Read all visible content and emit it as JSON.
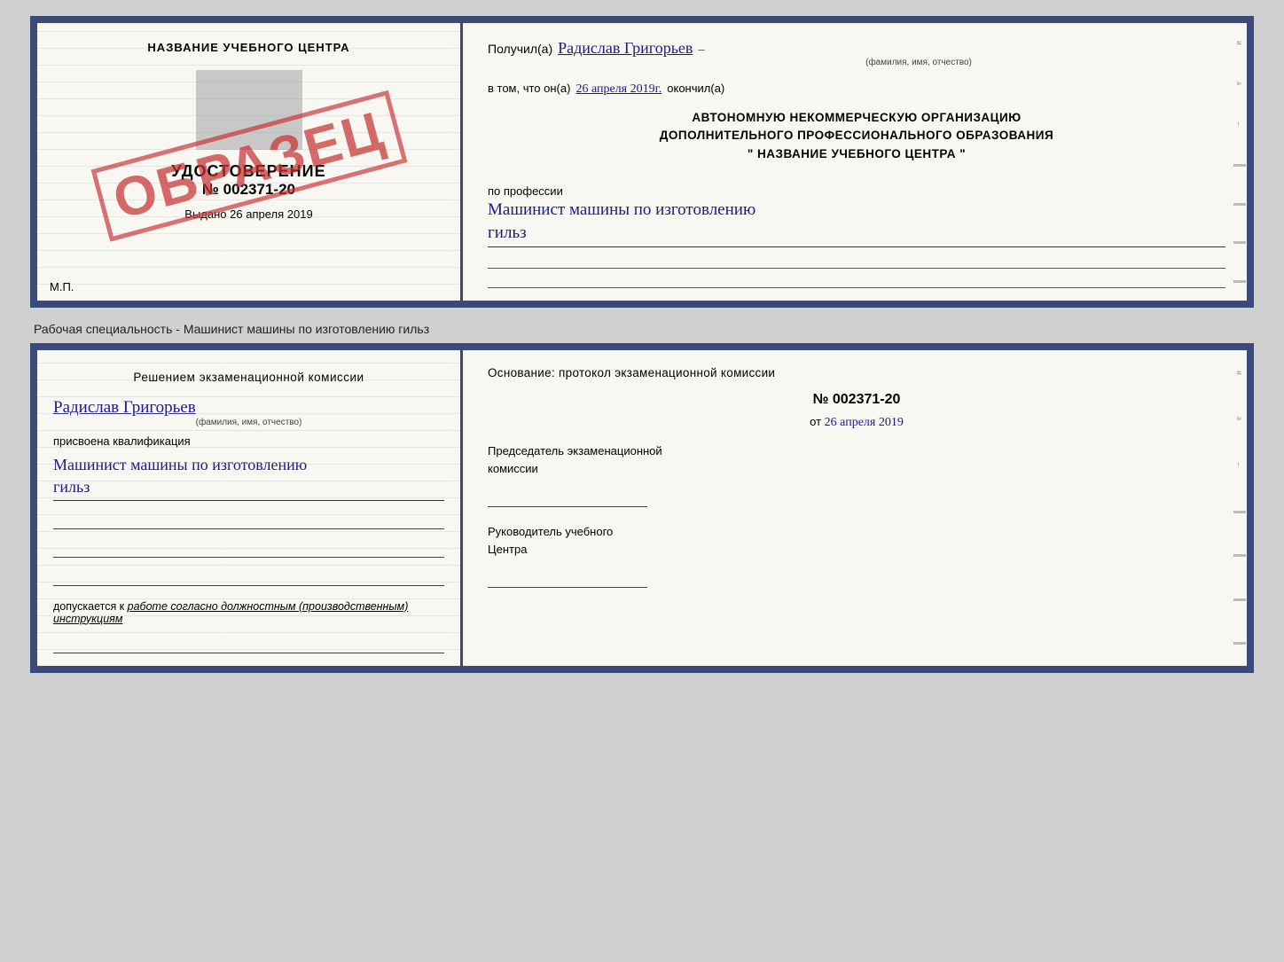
{
  "top_cert": {
    "left": {
      "school_name": "НАЗВАНИЕ УЧЕБНОГО ЦЕНТРА",
      "udostoverenie_label": "УДОСТОВЕРЕНИЕ",
      "udostoverenie_number": "№ 002371-20",
      "vidan_label": "Выдано",
      "vidan_date": "26 апреля 2019",
      "mp_label": "М.П.",
      "obrazec": "ОБРАЗЕЦ"
    },
    "right": {
      "poluchil_prefix": "Получил(а)",
      "poluchil_name": "Радислав Григорьев",
      "poluchil_caption": "(фамилия, имя, отчество)",
      "vtom_prefix": "в том, что он(а)",
      "vtom_date": "26 апреля 2019г.",
      "vtom_suffix": "окончил(а)",
      "body_line1": "АВТОНОМНУЮ НЕКОММЕРЧЕСКУЮ ОРГАНИЗАЦИЮ",
      "body_line2": "ДОПОЛНИТЕЛЬНОГО ПРОФЕССИОНАЛЬНОГО ОБРАЗОВАНИЯ",
      "body_line3": "\"   НАЗВАНИЕ УЧЕБНОГО ЦЕНТРА   \"",
      "po_professii_label": "по профессии",
      "profession_handwritten": "Машинист машины по изготовлению",
      "profession_line2": "гильз"
    }
  },
  "middle_label": "Рабочая специальность - Машинист машины по изготовлению гильз",
  "bottom_cert": {
    "left": {
      "decision_text": "Решением  экзаменационной  комиссии",
      "name_handwritten": "Радислав Григорьев",
      "name_caption": "(фамилия, имя, отчество)",
      "prisvoena_label": "присвоена квалификация",
      "profession_handwritten": "Машинист машины по изготовлению",
      "profession_line2": "гильз",
      "dopuskaetsya_prefix": "допускается к",
      "dopuskaetsya_italic": "работе согласно должностным (производственным) инструкциям"
    },
    "right": {
      "osnov_title": "Основание: протокол экзаменационной  комиссии",
      "number": "№  002371-20",
      "ot_prefix": "от",
      "ot_date": "26 апреля 2019",
      "predsed_label": "Председатель экзаменационной",
      "predsed_label2": "комиссии",
      "rukivod_label": "Руководитель учебного",
      "rukivod_label2": "Центра"
    }
  }
}
